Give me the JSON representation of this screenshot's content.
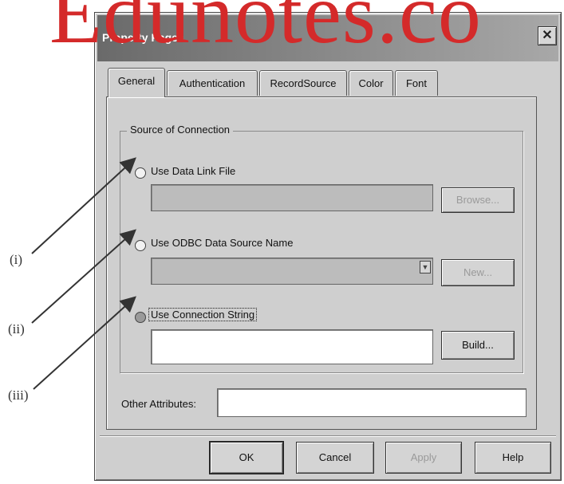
{
  "watermark": "Edunotes.co",
  "window": {
    "title": "Property Pages",
    "close_glyph": "✕"
  },
  "tabs": [
    {
      "label": "General",
      "active": true
    },
    {
      "label": "Authentication",
      "active": false
    },
    {
      "label": "RecordSource",
      "active": false
    },
    {
      "label": "Color",
      "active": false
    },
    {
      "label": "Font",
      "active": false
    }
  ],
  "connection": {
    "group_label": "Source of Connection",
    "data_link_label": "Use Data Link File",
    "browse_label": "Browse...",
    "odbc_label": "Use ODBC Data Source Name",
    "new_label": "New...",
    "conn_string_label": "Use Connection String",
    "build_label": "Build..."
  },
  "other_attributes_label": "Other Attributes:",
  "buttons": {
    "ok": "OK",
    "cancel": "Cancel",
    "apply": "Apply",
    "help": "Help"
  },
  "callouts": [
    "(i)",
    "(ii)",
    "(iii)"
  ],
  "icons": {
    "close": "close-icon",
    "dropdown": "chevron-down-icon"
  },
  "colors": {
    "dialog": "#cfcfcf",
    "watermark": "#d42a2a",
    "arrows": "#333333"
  }
}
